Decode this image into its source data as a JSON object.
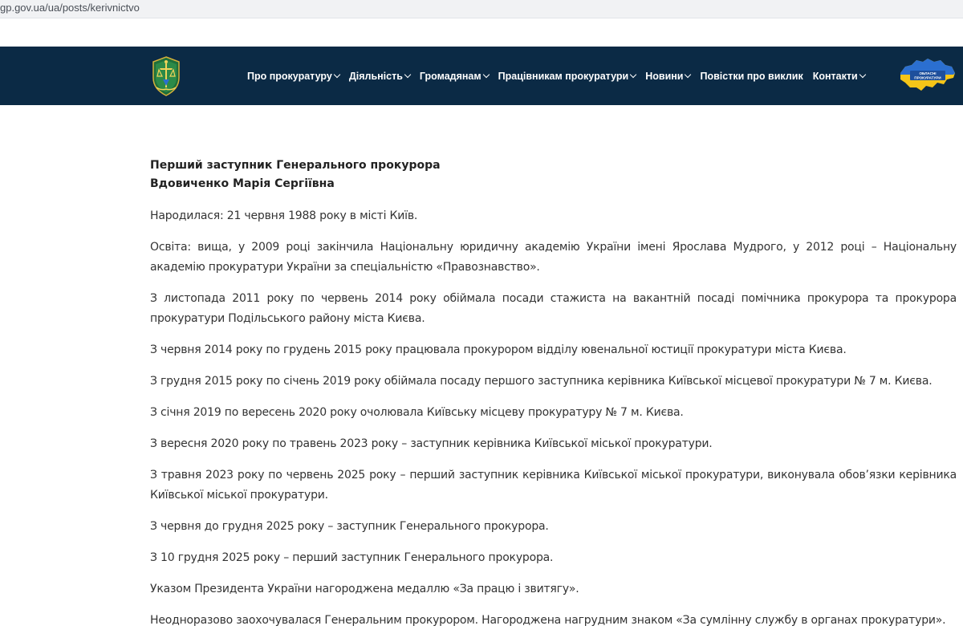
{
  "browser": {
    "url": "gp.gov.ua/ua/posts/kerivnictvo"
  },
  "header": {
    "colors": {
      "background": "#0b2a45",
      "text": "#ffffff"
    },
    "logo_icon": "prosecutor-emblem",
    "regions_icon": "ukraine-map",
    "regions_label_1": "ОБЛАСНІ",
    "regions_label_2": "ПРОКУРАТУРИ",
    "menu": [
      {
        "label": "Про прокуратуру",
        "dropdown": true
      },
      {
        "label": "Діяльність",
        "dropdown": true
      },
      {
        "label": "Громадянам",
        "dropdown": true
      },
      {
        "label": "Працівникам прокуратури",
        "dropdown": true
      },
      {
        "label": "Новини",
        "dropdown": true
      },
      {
        "label": "Повістки про виклик",
        "dropdown": false
      },
      {
        "label": "Контакти",
        "dropdown": true
      }
    ]
  },
  "profile": {
    "position": "Перший заступник Генерального прокурора",
    "name": "Вдовиченко Марія Сергіївна",
    "paragraphs": [
      "Народилася: 21 червня 1988 року в місті Київ.",
      "Освіта: вища, у 2009 році закінчила Національну юридичну академію України імені Ярослава Мудрого, у 2012 році – Національну академію прокуратури України за спеціальністю «Правознавство».",
      "З листопада 2011 року по червень 2014 року обіймала посади стажиста на вакантній посаді помічника прокурора та прокурора прокуратури Подільського району міста Києва.",
      "З червня 2014 року по грудень 2015 року працювала прокурором відділу ювенальної юстиції прокуратури міста Києва.",
      "З грудня 2015 року по січень 2019 року обіймала посаду першого заступника керівника Київської місцевої прокуратури № 7 м. Києва.",
      "З січня 2019 по вересень 2020 року очолювала Київську місцеву прокуратуру № 7 м. Києва.",
      "З вересня 2020 року по травень 2023 року – заступник керівника Київської міської прокуратури.",
      "З травня 2023 року по червень 2025 року – перший заступник керівника Київської міської прокуратури, виконувала обов’язки керівника Київської міської прокуратури.",
      "З червня до грудня 2025 року – заступник Генерального прокурора.",
      "З 10 грудня 2025 року – перший заступник Генерального прокурора.",
      "Указом Президента України нагороджена медаллю «За працю і звитягу».",
      "Неодноразово заохочувалася Генеральним прокурором. Нагороджена нагрудним знаком «За сумлінну службу в органах прокуратури»."
    ]
  }
}
